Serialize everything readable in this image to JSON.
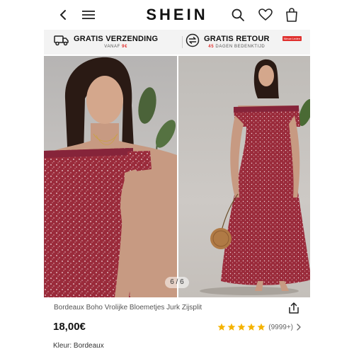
{
  "header": {
    "logo": "SHEIN",
    "icons": [
      "back-icon",
      "menu-icon",
      "search-icon",
      "heart-icon",
      "bag-icon"
    ]
  },
  "promo": {
    "left_title": "GRATIS VERZENDING",
    "left_sub_prefix": "VANAF",
    "left_sub_amount": "9€",
    "right_title": "GRATIS RETOUR",
    "right_sub_prefix": "45",
    "right_sub_text": "DAGEN BEDENKTIJD",
    "right_badge": "Nieuw Leden"
  },
  "gallery": {
    "counter": "6 / 6"
  },
  "product": {
    "title": "Bordeaux Boho Vrolijke Bloemetjes Jurk Zijsplit",
    "price": "18,00€",
    "rating_stars": 5,
    "review_count": "(9999+)",
    "color_label": "Kleur: Bordeaux"
  },
  "colors": {
    "accent_red": "#e0302e",
    "star_yellow": "#f5b301",
    "dress_primary": "#9a2b3b"
  }
}
